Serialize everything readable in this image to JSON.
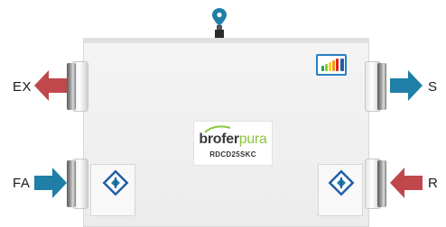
{
  "labels": {
    "ex": "EX",
    "fa": "FA",
    "s": "S",
    "r": "R"
  },
  "brand": {
    "name_dark": "brofer",
    "name_light": "pura",
    "model": "RDCD25SKC"
  },
  "colors": {
    "exhaust_arrow": "#c0474b",
    "return_arrow": "#c0474b",
    "supply_arrow": "#1f7fa6",
    "fresh_air_arrow": "#1f7fa6",
    "brand_green": "#8cc63f",
    "pin": "#1f7fa6"
  },
  "icons": [
    "location-pin-icon",
    "energy-label-icon",
    "filter-icon"
  ]
}
